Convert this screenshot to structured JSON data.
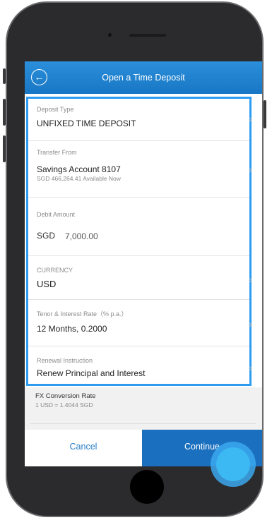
{
  "header": {
    "title": "Open a Time Deposit"
  },
  "fields": [
    {
      "label": "Deposit Type",
      "value": "UNFIXED TIME DEPOSIT"
    },
    {
      "label": "Transfer From",
      "value": "Savings Account 8107",
      "sub": "SGD 466,264.41 Available Now"
    },
    {
      "label": "Debit Amount",
      "currency": "SGD",
      "amount": "7,000.00"
    },
    {
      "label": "CURRENCY",
      "value": "USD"
    },
    {
      "label": "Tenor & Interest Rate（% p.a.）",
      "value": "12 Months, 0.2000"
    },
    {
      "label": "Renewal Instruction",
      "value": "Renew Principal and Interest"
    }
  ],
  "fx": {
    "label": "FX Conversion Rate",
    "value": "1 USD = 1.4044 SGD"
  },
  "buttons": {
    "cancel": "Cancel",
    "continue": "Continue"
  },
  "icons": {
    "back": "arrow-left-icon",
    "chevron": "chevron-right-icon"
  },
  "colors": {
    "header": "#1877c4",
    "highlight": "#2d9cf0",
    "continue": "#1a6fbf",
    "cancel_text": "#2a7fc7"
  }
}
